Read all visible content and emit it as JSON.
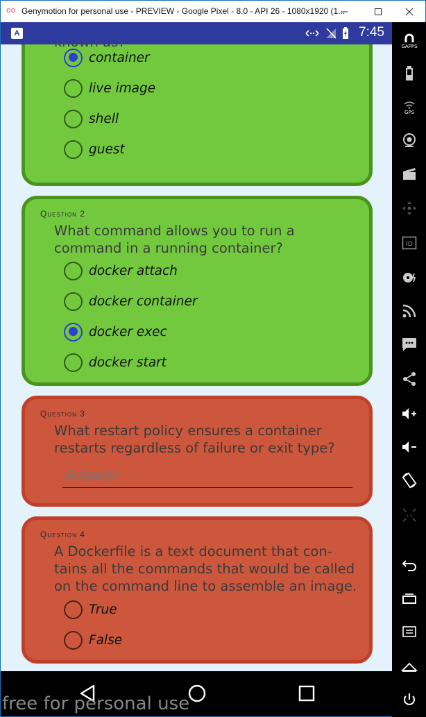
{
  "window": {
    "title": "Genymotion for personal use - PREVIEW - Google Pixel - 8.0 - API 26 - 1080x1920 (1...",
    "logo": "oo"
  },
  "statusbar": {
    "app_letter": "A",
    "time": "7:45"
  },
  "questions": [
    {
      "number": "",
      "text": "known as?",
      "options": [
        {
          "label": "container",
          "selected": true
        },
        {
          "label": "live image",
          "selected": false
        },
        {
          "label": "shell",
          "selected": false
        },
        {
          "label": "guest",
          "selected": false
        }
      ],
      "status_color": "#72c93e"
    },
    {
      "number": "Question 2",
      "text": "What command allows you to run a command in a running container?",
      "options": [
        {
          "label": "docker attach",
          "selected": false
        },
        {
          "label": "docker container",
          "selected": false
        },
        {
          "label": "docker exec",
          "selected": true
        },
        {
          "label": "docker start",
          "selected": false
        }
      ],
      "status_color": "#72c93e"
    },
    {
      "number": "Question 3",
      "text": "What restart policy ensures a container restarts regardless of failure or exit type?",
      "answer_placeholder": "Answer",
      "status_color": "#cc573d"
    },
    {
      "number": "Question 4",
      "text": "A Dockerfile is a text document that con-tains all the commands that would be called on the command line to assemble an image.",
      "options": [
        {
          "label": "True",
          "selected": false
        },
        {
          "label": "False",
          "selected": false
        }
      ],
      "status_color": "#cc573d"
    }
  ],
  "sidebar": {
    "gapps_label": "GAPPS",
    "gps_label": "GPS",
    "id_label": "ID"
  },
  "watermark": "free for personal use",
  "colors": {
    "accent": "#2c3fd6",
    "statusbar": "#2e3a9e",
    "correct": "#72c93e",
    "incorrect": "#cc573d"
  }
}
